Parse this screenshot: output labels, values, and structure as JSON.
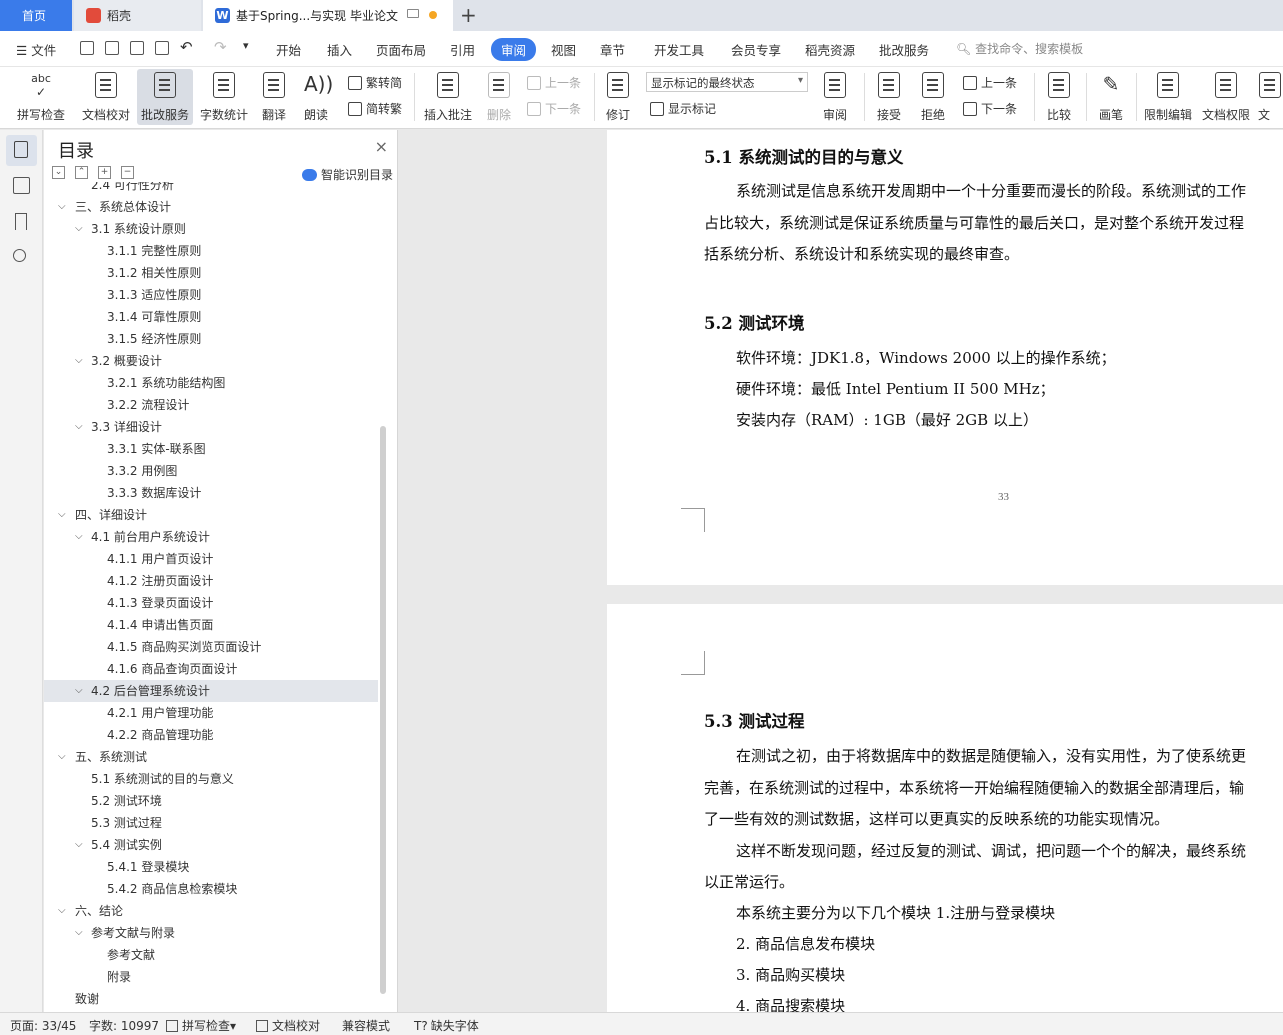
{
  "tabs": {
    "home": "首页",
    "doc1": "稻壳",
    "doc2": "基于Spring...与实现 毕业论文"
  },
  "menu": {
    "file": "文件",
    "items": [
      "开始",
      "插入",
      "页面布局",
      "引用",
      "审阅",
      "视图",
      "章节",
      "开发工具",
      "会员专享",
      "稻壳资源",
      "批改服务"
    ],
    "active": "审阅",
    "search": "查找命令、搜索模板"
  },
  "ribbon": {
    "spell": "拼写检查",
    "doc_check": "文档校对",
    "correct_service": "批改服务",
    "word_count": "字数统计",
    "translate": "翻译",
    "read_aloud": "朗读",
    "trad": "繁转简",
    "simp": "简转繁",
    "insert_comment": "插入批注",
    "delete": "删除",
    "prev": "上一条",
    "next": "下一条",
    "revise": "修订",
    "markup_state": "显示标记的最终状态",
    "show_markup": "显示标记",
    "review": "审阅",
    "accept": "接受",
    "reject": "拒绝",
    "prev2": "上一条",
    "next2": "下一条",
    "compare": "比较",
    "pen": "画笔",
    "restrict_edit": "限制编辑",
    "doc_permission": "文档权限",
    "doc_cut": "文"
  },
  "toc": {
    "title": "目录",
    "smart": "智能识别目录",
    "items": [
      {
        "label": "2.4 可行性分析",
        "level": 1,
        "arrow": false
      },
      {
        "label": "三、系统总体设计",
        "level": 0,
        "arrow": true
      },
      {
        "label": "3.1 系统设计原则",
        "level": 1,
        "arrow": true
      },
      {
        "label": "3.1.1 完整性原则",
        "level": 2,
        "arrow": false
      },
      {
        "label": "3.1.2 相关性原则",
        "level": 2,
        "arrow": false
      },
      {
        "label": "3.1.3  适应性原则",
        "level": 2,
        "arrow": false
      },
      {
        "label": "3.1.4 可靠性原则",
        "level": 2,
        "arrow": false
      },
      {
        "label": "3.1.5 经济性原则",
        "level": 2,
        "arrow": false
      },
      {
        "label": "3.2  概要设计",
        "level": 1,
        "arrow": true
      },
      {
        "label": "3.2.1  系统功能结构图",
        "level": 2,
        "arrow": false
      },
      {
        "label": "3.2.2  流程设计",
        "level": 2,
        "arrow": false
      },
      {
        "label": "3.3  详细设计",
        "level": 1,
        "arrow": true
      },
      {
        "label": "3.3.1  实体-联系图",
        "level": 2,
        "arrow": false
      },
      {
        "label": "3.3.2  用例图",
        "level": 2,
        "arrow": false
      },
      {
        "label": "3.3.3 数据库设计",
        "level": 2,
        "arrow": false
      },
      {
        "label": "四、详细设计",
        "level": 0,
        "arrow": true
      },
      {
        "label": "4.1 前台用户系统设计",
        "level": 1,
        "arrow": true
      },
      {
        "label": "4.1.1 用户首页设计",
        "level": 2,
        "arrow": false
      },
      {
        "label": "4.1.2 注册页面设计",
        "level": 2,
        "arrow": false
      },
      {
        "label": "4.1.3 登录页面设计",
        "level": 2,
        "arrow": false
      },
      {
        "label": "4.1.4 申请出售页面",
        "level": 2,
        "arrow": false
      },
      {
        "label": "4.1.5 商品购买浏览页面设计",
        "level": 2,
        "arrow": false
      },
      {
        "label": "4.1.6 商品查询页面设计",
        "level": 2,
        "arrow": false
      },
      {
        "label": "4.2 后台管理系统设计",
        "level": 1,
        "arrow": true,
        "selected": true
      },
      {
        "label": "4.2.1 用户管理功能",
        "level": 2,
        "arrow": false
      },
      {
        "label": "4.2.2 商品管理功能",
        "level": 2,
        "arrow": false
      },
      {
        "label": "五、系统测试",
        "level": 0,
        "arrow": true
      },
      {
        "label": "5.1 系统测试的目的与意义",
        "level": 1,
        "arrow": false
      },
      {
        "label": "5.2 测试环境",
        "level": 1,
        "arrow": false
      },
      {
        "label": "5.3  测试过程",
        "level": 1,
        "arrow": false
      },
      {
        "label": "5.4  测试实例",
        "level": 1,
        "arrow": true
      },
      {
        "label": "5.4.1  登录模块",
        "level": 2,
        "arrow": false
      },
      {
        "label": "5.4.2  商品信息检索模块",
        "level": 2,
        "arrow": false
      },
      {
        "label": "六、结论",
        "level": 0,
        "arrow": true
      },
      {
        "label": "参考文献与附录",
        "level": 1,
        "arrow": true
      },
      {
        "label": "参考文献",
        "level": 2,
        "arrow": false
      },
      {
        "label": "附录",
        "level": 2,
        "arrow": false
      },
      {
        "label": "致谢",
        "level": 0,
        "arrow": false
      }
    ]
  },
  "doc": {
    "h51": "5.1 系统测试的目的与意义",
    "p51": [
      "系统测试是信息系统开发周期中一个十分重要而漫长的阶段。系统测试的工作",
      "占比较大，系统测试是保证系统质量与可靠性的最后关口，是对整个系统开发过程",
      "括系统分析、系统设计和系统实现的最终审查。"
    ],
    "h52": "5.2 测试环境",
    "p52": [
      "软件环境：JDK1.8，Windows 2000 以上的操作系统；",
      "硬件环境：最低 Intel  Pentium  II   500  MHz；",
      "安装内存（RAM）:   1GB（最好 2GB 以上）"
    ],
    "page_number": "33",
    "h53": "5.3  测试过程",
    "p53": [
      "在测试之初，由于将数据库中的数据是随便输入，没有实用性，为了使系统更",
      "完善，在系统测试的过程中，本系统将一开始编程随便输入的数据全部清理后，输",
      "了一些有效的测试数据，这样可以更真实的反映系统的功能实现情况。",
      "这样不断发现问题，经过反复的测试、调试，把问题一个个的解决，最终系统",
      "以正常运行。",
      "本系统主要分为以下几个模块  1.注册与登录模块",
      "2.  商品信息发布模块",
      "3.  商品购买模块",
      "4.  商品搜索模块"
    ]
  },
  "status": {
    "page": "页面: 33/45",
    "words": "字数: 10997",
    "spell": "拼写检查",
    "doc_check": "文档校对",
    "compat": "兼容模式",
    "missing_font": "缺失字体"
  },
  "colors": {
    "accent": "#3a7bea"
  }
}
